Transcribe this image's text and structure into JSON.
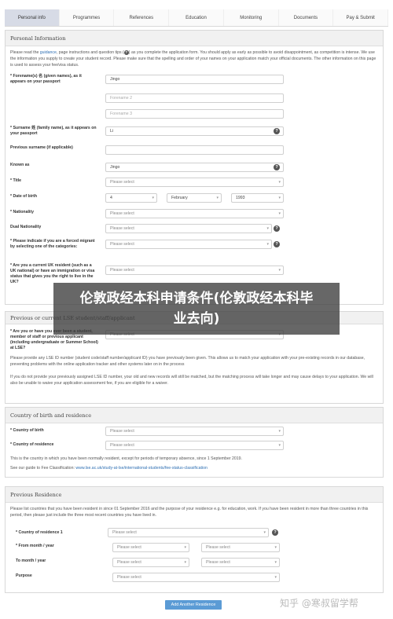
{
  "tabs": [
    "Personal info",
    "Programmes",
    "References",
    "Education",
    "Monitoring",
    "Documents",
    "Pay & Submit"
  ],
  "personal": {
    "title": "Personal Information",
    "intro_a": "Please read the ",
    "intro_link": "guidance",
    "intro_b": ", page instructions and question tips (",
    "intro_c": ") as you complete the application form. You should apply as early as possible to avoid disappointment, as competition is intense. We use the information you supply to create your student record. Please make sure that the spelling and order of your names on your application match your official documents. The other information on this page is used to assess your fee/visa status.",
    "forenames_label": "* Forename(s) 名 (given names), as it appears on your passport",
    "forename1": "Jingo",
    "forename2_ph": "Forename 2",
    "forename3_ph": "Forename 3",
    "surname_label": "* Surname 姓 (family name), as it appears on your passport",
    "surname": "Li",
    "prev_surname_label": "Previous surname (if applicable)",
    "known_as_label": "Known as",
    "known_as": "Jingo",
    "title_label": "* Title",
    "please_select": "Please select",
    "dob_label": "* Date of birth",
    "dob_day": "4",
    "dob_month": "February",
    "dob_year": "1993",
    "nationality_label": "* Nationality",
    "dual_label": "Dual Nationality",
    "migrant_label": "* Please indicate if you are a forced migrant by selecting one of the categories:",
    "uk_label": "* Are you a current UK resident (such as a UK national) or have an immigration or visa status that gives you the right to live in the UK?"
  },
  "banner": "伦敦政经本科申请条件(伦敦政经本科毕业去向)",
  "previous_lse": {
    "title": "Previous or current LSE student/staff/applicant",
    "q_label": "* Are you or have you ever been a student, member of staff or previous applicant (including undergraduate or Summer School) at LSE?",
    "p1": "Please provide any LSE ID number (student code/staff number/applicant ID) you have previously been given. This allows us to match your application with your pre-existing records in our database, preventing problems with the online application tracker and other systems later on in the process",
    "p2": "If you do not provide your previously assigned LSE ID number, your old and new records will still be matched, but the matching process will take longer and may cause delays to your application. We will also be unable to waive your application assessment fee, if you are eligible for a waiver."
  },
  "country": {
    "title": "Country of birth and residence",
    "birth_label": "* Country of birth",
    "res_label": "* Country of residence",
    "note": "This is the country in which you have been normally resident, except for periods of temporary absence, since 1 September 2019.",
    "guide_a": "See our guide to Fee Classification: ",
    "guide_link": "www.lse.ac.uk/study-at-lse/international-students/fee-status-classification"
  },
  "prev_res": {
    "title": "Previous Residence",
    "intro": "Please list countries that you have been resident in since 01 September 2016 and the purpose of your residence e.g. for education, work. If you have been resident in more than three countries in this period, then please just include the three most recent countries you have lived in.",
    "country_label": "* Country of residence 1",
    "from_label": "* From month / year",
    "to_label": "To month / year",
    "purpose_label": "Purpose",
    "add_button": "Add Another Residence"
  },
  "watermark": "知乎 @寒叔留学帮"
}
